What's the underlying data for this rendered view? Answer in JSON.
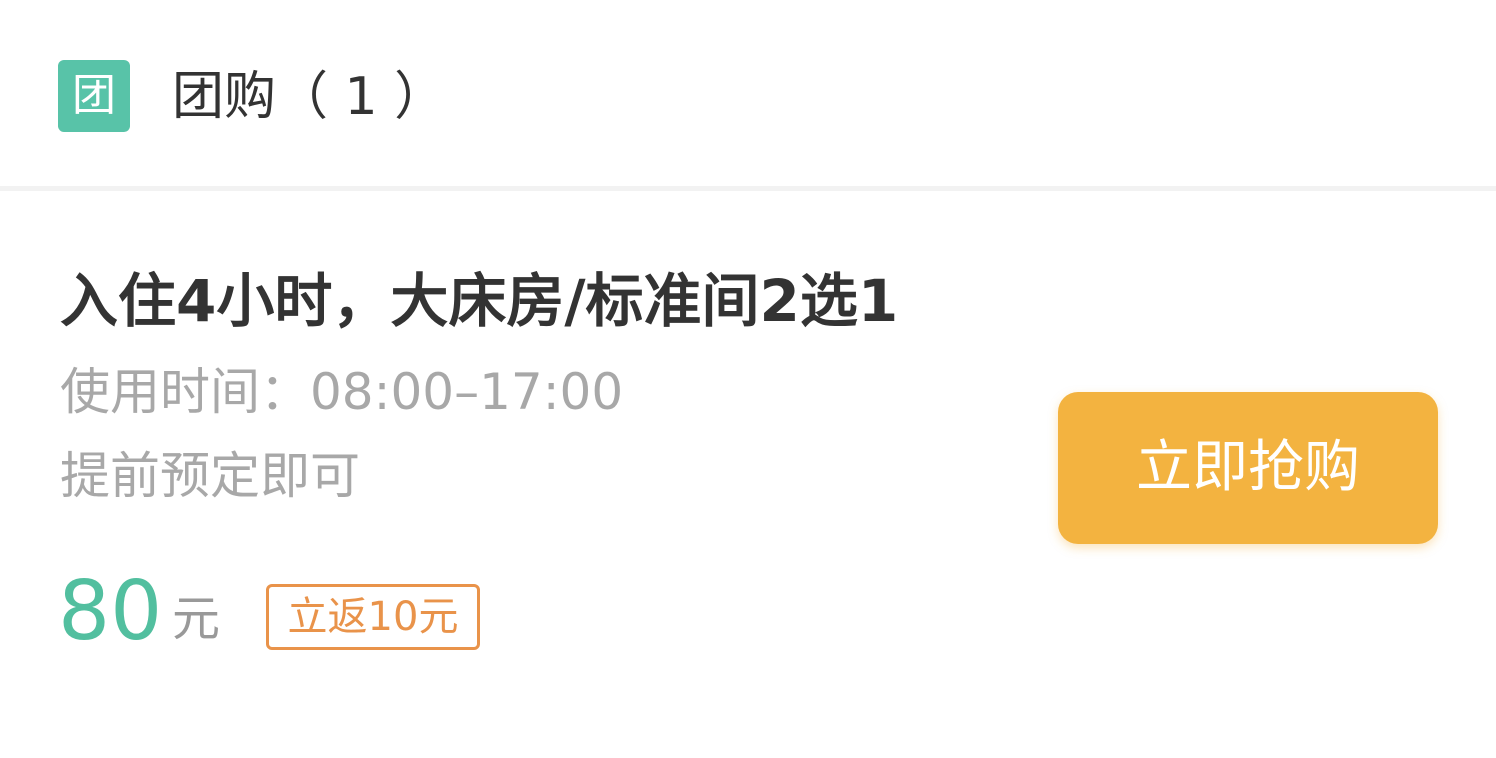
{
  "section": {
    "badge_text": "团",
    "badge_color": "#58c3a8",
    "title": "团购（ 1 ）"
  },
  "deal": {
    "title": "入住4小时，大床房/标准间2选1",
    "usage_time": "使用时间：08:00–17:00",
    "note": "提前预定即可",
    "price": "80",
    "price_unit": "元",
    "rebate_tag": "立返10元",
    "buy_button_label": "立即抢购"
  },
  "colors": {
    "accent_green": "#52bf9f",
    "button_orange": "#f3b340",
    "tag_orange": "#e9934a",
    "text_dark": "#333333",
    "text_gray": "#a8a8a8"
  }
}
